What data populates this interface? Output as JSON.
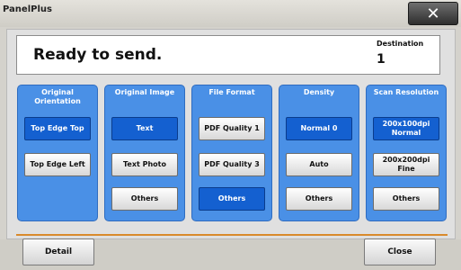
{
  "window": {
    "title": "PanelPlus",
    "close_glyph": "✕"
  },
  "status": {
    "message": "Ready to send.",
    "destination_label": "Destination",
    "destination_value": "1"
  },
  "panels": [
    {
      "title": "Original Orientation",
      "options": [
        "Top Edge Top",
        "Top Edge Left"
      ],
      "selected": 0
    },
    {
      "title": "Original Image",
      "options": [
        "Text",
        "Text Photo",
        "Others"
      ],
      "selected": 0
    },
    {
      "title": "File Format",
      "options": [
        "PDF Quality 1",
        "PDF Quality 3",
        "Others"
      ],
      "selected": 2
    },
    {
      "title": "Density",
      "options": [
        "Normal 0",
        "Auto",
        "Others"
      ],
      "selected": 0
    },
    {
      "title": "Scan Resolution",
      "options": [
        "200x100dpi Normal",
        "200x200dpi Fine",
        "Others"
      ],
      "selected": 0
    }
  ],
  "footer": {
    "detail_label": "Detail",
    "close_label": "Close"
  },
  "colors": {
    "panel": "#4a90e6",
    "selected": "#1460d0",
    "divider": "#d98a2c"
  }
}
